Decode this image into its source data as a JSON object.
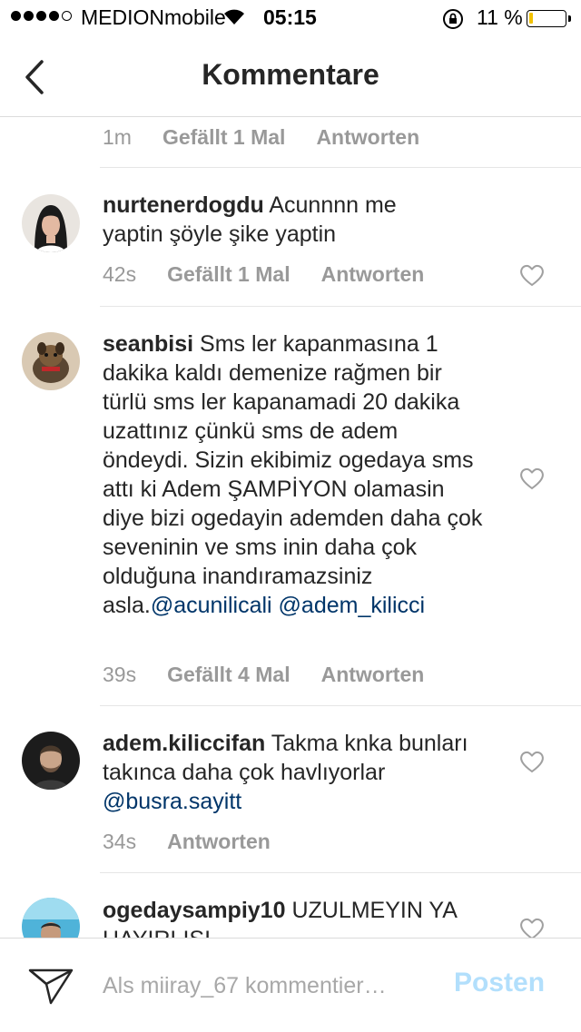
{
  "status_bar": {
    "carrier": "MEDIONmobile",
    "time": "05:15",
    "battery": "11 %",
    "battery_level": 0.11,
    "signal_bars_filled": 4,
    "signal_bars_total": 5
  },
  "nav": {
    "title": "Kommentare",
    "back_icon": "chevron-left-icon"
  },
  "top_meta": {
    "time": "1m",
    "likes": "Gefällt 1 Mal",
    "reply": "Antworten"
  },
  "comments": [
    {
      "username": "nurtenerdogdu",
      "text_line1": "Acunnnn me",
      "text_rest": "yaptin şöyle şike yaptin",
      "time": "42s",
      "likes": "Gefällt 1 Mal",
      "reply": "Antworten"
    },
    {
      "username": "seanbisi",
      "text": "Sms ler kapanmasına 1 dakika kaldı demenize rağmen bir türlü sms ler kapanamadi 20 dakika uzattınız çünkü sms de adem öndeydi. Sizin ekibimiz ogedaya sms attı ki Adem ŞAMPİYON olamasin diye  bizi ogedayin ademden daha çok seveninin ve  sms inin daha çok olduğuna inandıramazsiniz asla.",
      "mention1": "@acunilicali",
      "mention2": "@adem_kilicci",
      "time": "39s",
      "likes": "Gefällt 4 Mal",
      "reply": "Antworten"
    },
    {
      "username": "adem.kiliccifan",
      "text": "Takma knka bunları takınca daha çok havlıyorlar",
      "mention": "@busra.sayitt",
      "time": "34s",
      "reply": "Antworten"
    },
    {
      "username": "ogedaysampiy10",
      "text": "UZULMEYIN YA HAYIRLISI"
    }
  ],
  "composer": {
    "placeholder": "Als miiray_67 kommentier…",
    "post_label": "Posten"
  },
  "colors": {
    "mention": "#003569",
    "meta": "#999999",
    "post_disabled": "#b2dffc",
    "battery_fill": "#f2c200"
  }
}
